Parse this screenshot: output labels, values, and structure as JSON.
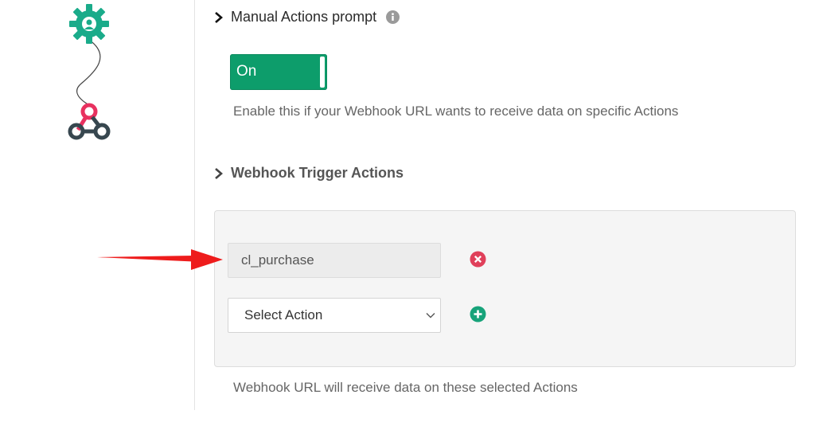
{
  "manual_actions": {
    "title": "Manual Actions prompt",
    "toggle_label": "On",
    "help_text": "Enable this if your Webhook URL wants to receive data on specific Actions"
  },
  "webhook_trigger": {
    "title": "Webhook Trigger Actions",
    "selected_actions": [
      "cl_purchase"
    ],
    "select_placeholder": "Select Action",
    "help_text": "Webhook URL will receive data on these selected Actions"
  },
  "colors": {
    "toggle_on": "#0d9d6b",
    "remove_icon": "#e0405a",
    "add_icon": "#17a37a",
    "gear_icon": "#1aab8a",
    "webhook_pink": "#e8315f",
    "annotation_arrow": "#ee1c1c"
  },
  "icons": {
    "gear": "gear-person-icon",
    "webhook": "webhook-icon",
    "chevron": "chevron-right-icon",
    "info": "info-icon",
    "remove": "remove-circle-icon",
    "add": "add-circle-icon",
    "caret": "chevron-down-icon"
  }
}
